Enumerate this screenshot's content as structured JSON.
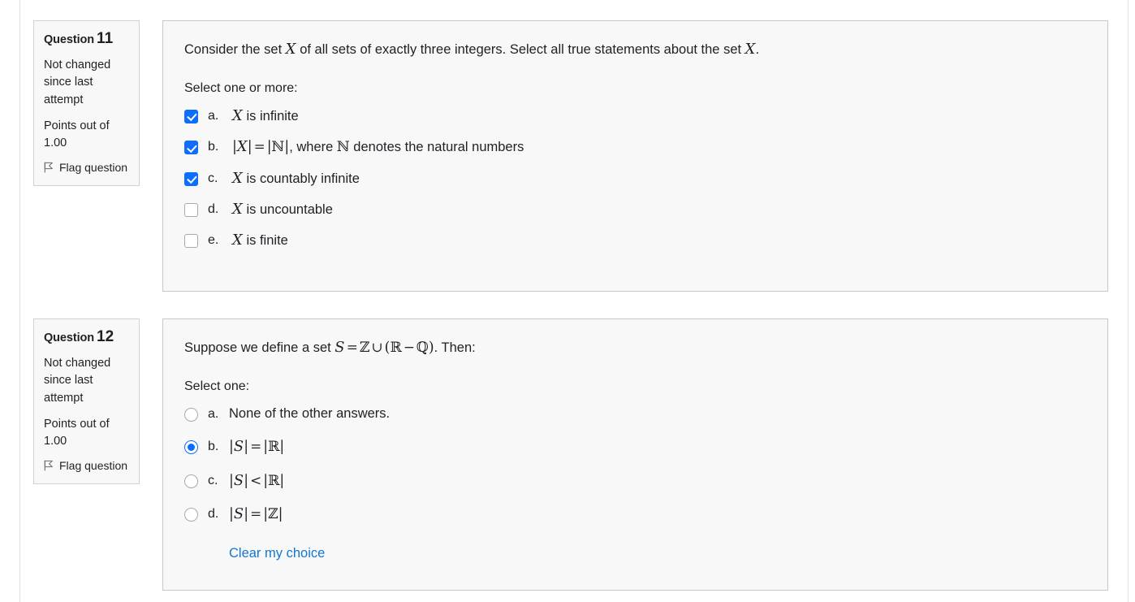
{
  "questions": [
    {
      "info": {
        "header_label": "Question",
        "number": "11",
        "state": "Not changed since last attempt",
        "grade": "Points out of 1.00",
        "flag_label": "Flag question",
        "flag_icon": "flag-icon"
      },
      "question_text": "Consider the set X of all sets of exactly three integers. Select all  true statements about the set X.",
      "question_parts": [
        {
          "t": "Consider the set ",
          "k": "plain"
        },
        {
          "t": "X",
          "k": "math"
        },
        {
          "t": " of all sets of exactly three integers. Select all  true statements about the set ",
          "k": "plain"
        },
        {
          "t": "X",
          "k": "math"
        },
        {
          "t": ".",
          "k": "plain"
        }
      ],
      "prompt": "Select one or more:",
      "input_type": "checkbox",
      "options": [
        {
          "label": "a.",
          "text": "X is infinite",
          "checked": true
        },
        {
          "label": "b.",
          "text": "|X| = |ℕ|, where ℕ denotes the natural numbers",
          "checked": true
        },
        {
          "label": "c.",
          "text": "X is countably infinite",
          "checked": true
        },
        {
          "label": "d.",
          "text": "X is uncountable",
          "checked": false
        },
        {
          "label": "e.",
          "text": "X is finite",
          "checked": false
        }
      ],
      "clear_choice": null
    },
    {
      "info": {
        "header_label": "Question",
        "number": "12",
        "state": "Not changed since last attempt",
        "grade": "Points out of 1.00",
        "flag_label": "Flag question",
        "flag_icon": "flag-icon"
      },
      "question_text": "Suppose we define a set S = ℤ ∪ (ℝ − ℚ). Then:",
      "prompt": "Select one:",
      "input_type": "radio",
      "options": [
        {
          "label": "a.",
          "text": "None of the other answers.",
          "checked": false
        },
        {
          "label": "b.",
          "text": "|S| = |ℝ|",
          "checked": true
        },
        {
          "label": "c.",
          "text": "|S| < |ℝ|",
          "checked": false
        },
        {
          "label": "d.",
          "text": "|S| = |ℤ|",
          "checked": false
        }
      ],
      "clear_choice": "Clear my choice"
    }
  ],
  "colors": {
    "accent": "#0d6efd",
    "link": "#1177d1",
    "box_bg": "#f8f8f8",
    "box_border": "#c8c8c8",
    "text": "#1d2125"
  }
}
